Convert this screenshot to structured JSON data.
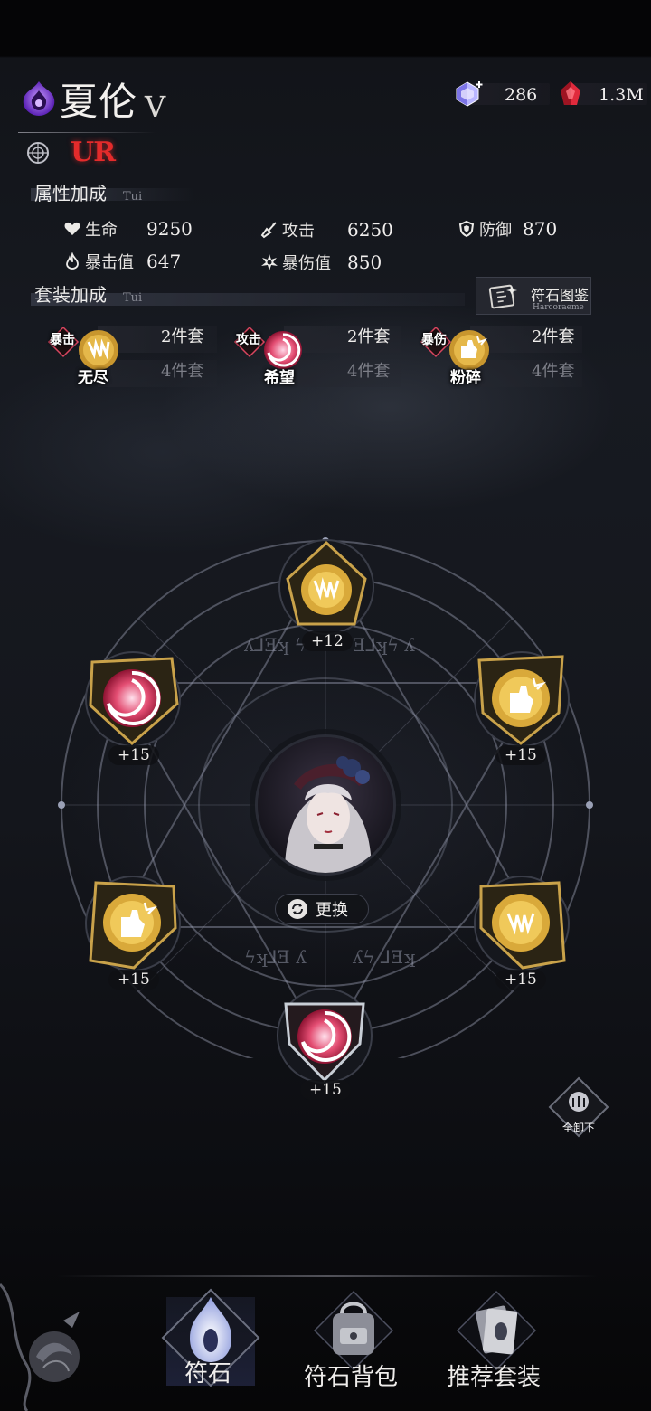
{
  "header": {
    "hero_name": "夏伦",
    "hero_rank": "V",
    "rarity": "UR",
    "currencies": [
      {
        "icon": "crystal-gem-icon",
        "value": "286"
      },
      {
        "icon": "red-gem-icon",
        "value": "1.3M"
      }
    ]
  },
  "attributes": {
    "title": "属性加成",
    "subtitle": "Tui",
    "stats": [
      {
        "icon": "heart-icon",
        "label": "生命",
        "value": "9250"
      },
      {
        "icon": "sword-icon",
        "label": "攻击",
        "value": "6250"
      },
      {
        "icon": "shield-icon",
        "label": "防御",
        "value": "870"
      },
      {
        "icon": "flame-icon",
        "label": "暴击值",
        "value": "647"
      },
      {
        "icon": "burst-icon",
        "label": "暴伤值",
        "value": "850"
      }
    ]
  },
  "sets": {
    "title": "套装加成",
    "subtitle": "Tui",
    "codex_button": {
      "label": "符石图鉴",
      "sublabel": "Harcoraeme"
    },
    "items": [
      {
        "tag": "暴击",
        "name": "无尽",
        "two_piece": "2件套",
        "four_piece": "4件套",
        "icon": "fang-rune-icon",
        "color": "#d9a93a"
      },
      {
        "tag": "攻击",
        "name": "希望",
        "two_piece": "2件套",
        "four_piece": "4件套",
        "icon": "swirl-rune-icon",
        "color": "#d9455f"
      },
      {
        "tag": "暴伤",
        "name": "粉碎",
        "two_piece": "2件套",
        "four_piece": "4件套",
        "icon": "fist-rune-icon",
        "color": "#d9a93a"
      }
    ]
  },
  "rune_slots": [
    {
      "position": "top",
      "icon": "fang-rune-icon",
      "level": "+12"
    },
    {
      "position": "upper-left",
      "icon": "swirl-rune-icon",
      "level": "+15"
    },
    {
      "position": "upper-right",
      "icon": "fist-rune-icon",
      "level": "+15"
    },
    {
      "position": "lower-left",
      "icon": "fist-rune-icon",
      "level": "+15"
    },
    {
      "position": "lower-right",
      "icon": "fang-rune-icon",
      "level": "+15"
    },
    {
      "position": "bottom",
      "icon": "swirl-rune-icon",
      "level": "+15"
    }
  ],
  "center": {
    "swap_label": "更换"
  },
  "unequip": {
    "label": "全卸下"
  },
  "bottom_nav": [
    {
      "icon": "rune-eye-icon",
      "label": "符石",
      "active": true
    },
    {
      "icon": "backpack-icon",
      "label": "符石背包",
      "active": false
    },
    {
      "icon": "card-deck-icon",
      "label": "推荐套装",
      "active": false
    }
  ],
  "colors": {
    "gold": "#d9a93a",
    "crimson": "#d9455f",
    "ur_red": "#e32b2b",
    "purple_emblem": "#7b3fd0"
  }
}
